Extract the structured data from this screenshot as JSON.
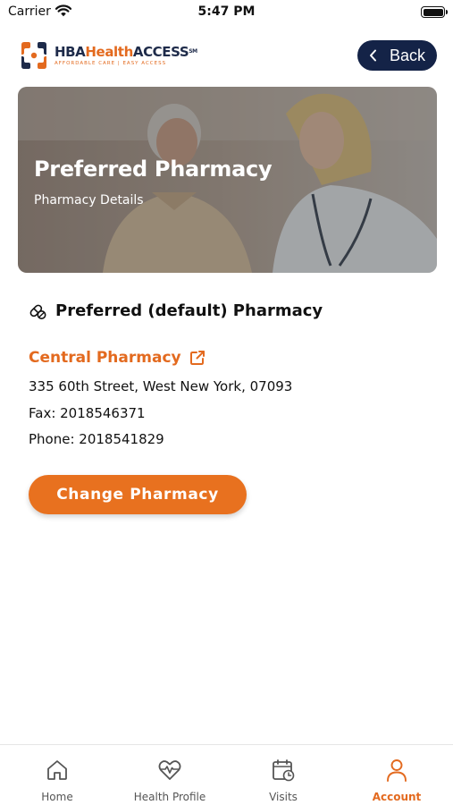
{
  "status_bar": {
    "carrier": "Carrier",
    "time": "5:47 PM"
  },
  "header": {
    "logo": {
      "hba": "HBA",
      "health": "Health",
      "access": "ACCESS",
      "tm": "SM",
      "tagline": "AFFORDABLE CARE | EASY ACCESS"
    },
    "back_label": "Back"
  },
  "hero": {
    "title": "Preferred Pharmacy",
    "subtitle": "Pharmacy Details"
  },
  "section": {
    "icon": "pills-icon",
    "title": "Preferred (default) Pharmacy"
  },
  "pharmacy": {
    "name": "Central Pharmacy",
    "link_icon": "external-link-icon",
    "address": "335 60th Street, West New York, 07093",
    "fax": "Fax: 2018546371",
    "phone": "Phone: 2018541829"
  },
  "actions": {
    "change_label": "Change Pharmacy"
  },
  "tabs": [
    {
      "label": "Home",
      "icon": "home-icon",
      "active": false
    },
    {
      "label": "Health Profile",
      "icon": "heart-pulse-icon",
      "active": false
    },
    {
      "label": "Visits",
      "icon": "calendar-clock-icon",
      "active": false
    },
    {
      "label": "Account",
      "icon": "user-icon",
      "active": true
    }
  ],
  "colors": {
    "brand_orange": "#E8711F",
    "brand_navy": "#142347",
    "active_tab": "#E36A1F"
  }
}
